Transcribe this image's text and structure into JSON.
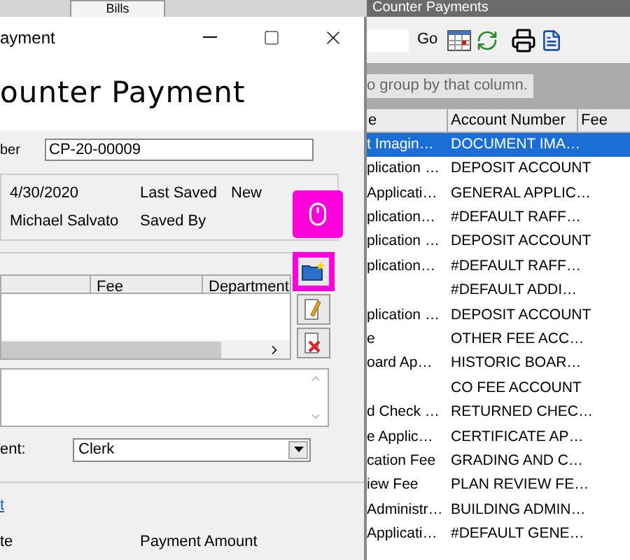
{
  "top_tab": "Bills",
  "background_window": {
    "title": "Counter Payments",
    "search_button": "Go",
    "group_hint": "o group by that column.",
    "columns": [
      "e",
      "Account Number",
      "Fee"
    ],
    "rows": [
      {
        "column_1": "t Imagin…",
        "account_number": "DOCUMENT IMA…",
        "selected": true
      },
      {
        "column_1": "plication …",
        "account_number": "DEPOSIT ACCOUNT",
        "selected": false
      },
      {
        "column_1": "Applicati…",
        "account_number": "GENERAL APPLIC…",
        "selected": false
      },
      {
        "column_1": "plication…",
        "account_number": "#DEFAULT RAFF…",
        "selected": false
      },
      {
        "column_1": "plication …",
        "account_number": "DEPOSIT ACCOUNT",
        "selected": false
      },
      {
        "column_1": "plication…",
        "account_number": "#DEFAULT RAFF…",
        "selected": false
      },
      {
        "column_1": "",
        "account_number": "#DEFAULT ADDI…",
        "selected": false
      },
      {
        "column_1": "plication …",
        "account_number": "DEPOSIT ACCOUNT",
        "selected": false
      },
      {
        "column_1": "e",
        "account_number": "OTHER FEE ACC…",
        "selected": false
      },
      {
        "column_1": "oard Ap…",
        "account_number": "HISTORIC BOAR…",
        "selected": false
      },
      {
        "column_1": "",
        "account_number": "CO FEE ACCOUNT",
        "selected": false
      },
      {
        "column_1": "d Check …",
        "account_number": "RETURNED CHEC…",
        "selected": false
      },
      {
        "column_1": "e Applic…",
        "account_number": "CERTIFICATE AP…",
        "selected": false
      },
      {
        "column_1": "cation Fee",
        "account_number": "GRADING AND C…",
        "selected": false
      },
      {
        "column_1": "iew Fee",
        "account_number": "PLAN REVIEW FE…",
        "selected": false
      },
      {
        "column_1": "Administr…",
        "account_number": "BUILDING ADMIN…",
        "selected": false
      },
      {
        "column_1": "Applicati…",
        "account_number": "#DEFAULT GENE…",
        "selected": false
      }
    ]
  },
  "dialog": {
    "title": "ayment",
    "heading": "ounter Payment",
    "number_label": "ber",
    "number_value": "CP-20-00009",
    "info": [
      {
        "value": "4/30/2020",
        "label": "Last Saved",
        "label_value": "New"
      },
      {
        "value": "Michael Salvato",
        "label": "Saved By"
      }
    ],
    "grid_columns": [
      "Fee",
      "Department"
    ],
    "side_buttons": [
      {
        "kind": "new",
        "highlighted": true
      },
      {
        "kind": "edit",
        "highlighted": false
      },
      {
        "kind": "delete",
        "highlighted": false
      }
    ],
    "department_label": "ent:",
    "department_value": "Clerk",
    "link": "t",
    "footer_labels": [
      "te",
      "Payment Amount"
    ]
  }
}
